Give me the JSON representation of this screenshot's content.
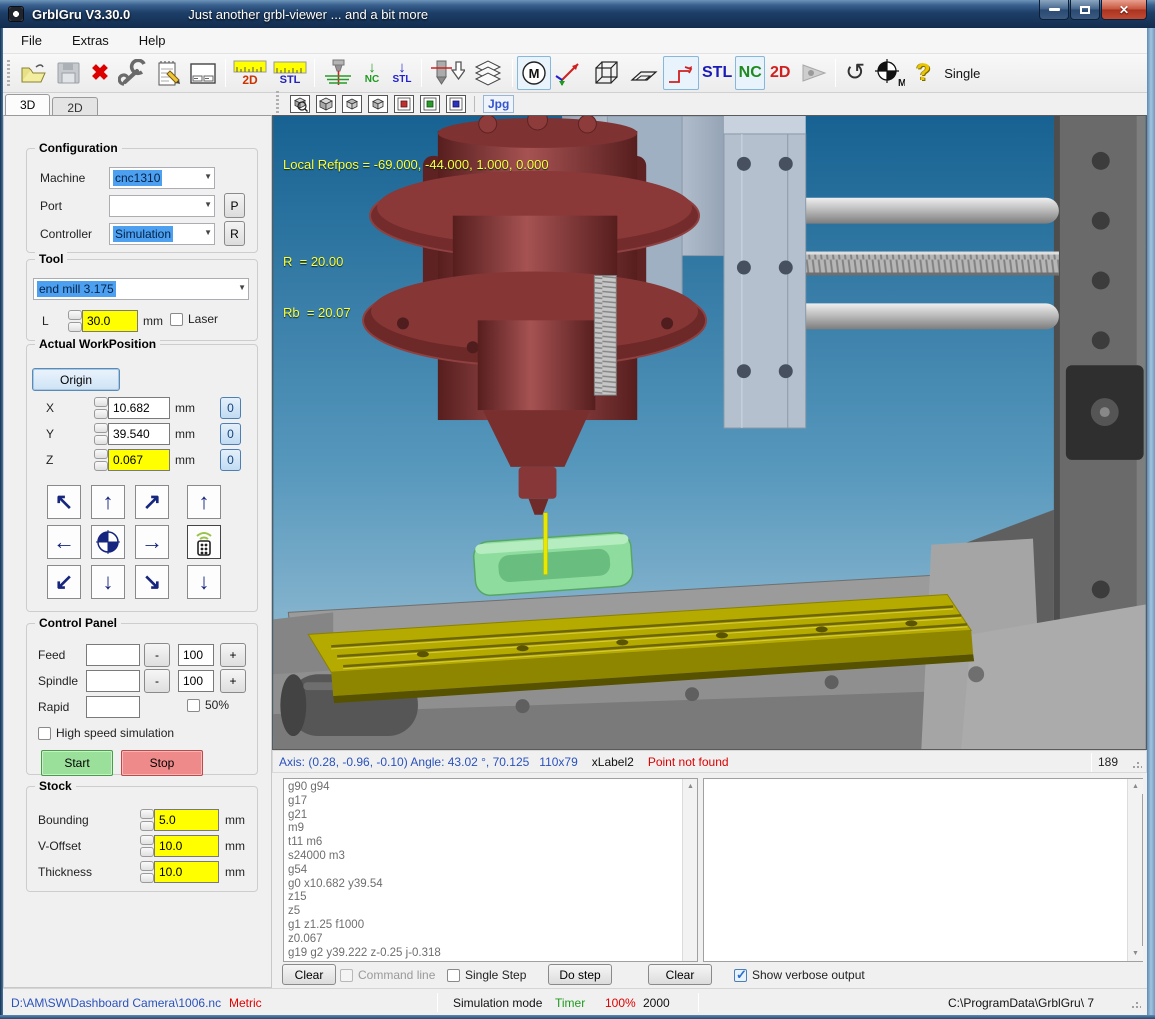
{
  "window": {
    "title": "GrblGru V3.30.0",
    "subtitle": "Just another grbl-viewer ... and a bit more"
  },
  "menu": {
    "file": "File",
    "extras": "Extras",
    "help": "Help"
  },
  "toolbar": {
    "ruler2d": "2D",
    "rulerstl": "STL",
    "nc_arrow": "NC",
    "stl_arrow": "STL",
    "m_badge": "M",
    "stl_text": "STL",
    "nc_text": "NC",
    "d2_text": "2D",
    "single": "Single"
  },
  "view_toolbar": {
    "jpg": "Jpg"
  },
  "tabs": {
    "t3d": "3D",
    "t2d": "2D"
  },
  "configuration": {
    "title": "Configuration",
    "machine_label": "Machine",
    "machine_value": "cnc1310",
    "port_label": "Port",
    "port_value": "",
    "controller_label": "Controller",
    "controller_value": "Simulation",
    "p_button": "P",
    "r_button": "R"
  },
  "tool": {
    "title": "Tool",
    "selected": "end mill 3.175",
    "l_label": "L",
    "length_value": "30.0",
    "unit": "mm",
    "laser_label": "Laser"
  },
  "work_position": {
    "title": "Actual WorkPosition",
    "origin_button": "Origin",
    "x_label": "X",
    "x_value": "10.682",
    "y_label": "Y",
    "y_value": "39.540",
    "z_label": "Z",
    "z_value": "0.067",
    "unit": "mm",
    "zero": "0"
  },
  "control_panel": {
    "title": "Control Panel",
    "feed_label": "Feed",
    "spindle_label": "Spindle",
    "rapid_label": "Rapid",
    "minus": "-",
    "plus": "+",
    "feed_percent": "100",
    "spindle_percent": "100",
    "fifty": "50%",
    "high_speed": "High speed simulation",
    "start": "Start",
    "stop": "Stop"
  },
  "stock": {
    "title": "Stock",
    "bounding_label": "Bounding",
    "bounding_value": "5.0",
    "voffset_label": "V-Offset",
    "voffset_value": "10.0",
    "thickness_label": "Thickness",
    "thickness_value": "10.0",
    "unit": "mm"
  },
  "viewport": {
    "overlay_refpos": "Local Refpos = -69.000, -44.000, 1.000, 0.000",
    "overlay_r": "R  = 20.00",
    "overlay_rb": "Rb  = 20.07"
  },
  "status_strip": {
    "axis_info": "Axis: (0.28, -0.96, -0.10) Angle: 43.02 °, 70.125   110x79",
    "xlabel": "xLabel2",
    "message": "Point not found",
    "counter": "189"
  },
  "gcode": {
    "lines": [
      "g90 g94",
      "g17",
      "g21",
      "m9",
      "t11 m6",
      "s24000 m3",
      "g54",
      "g0 x10.682 y39.54",
      "z15",
      "z5",
      "g1 z1.25 f1000",
      "z0.067",
      "g19 g2 y39.222 z-0.25 j-0.318"
    ]
  },
  "bottom_controls": {
    "clear_left": "Clear",
    "command_line": "Command line",
    "single_step": "Single Step",
    "do_step": "Do step",
    "clear_right": "Clear",
    "show_verbose": "Show verbose output"
  },
  "status_bar": {
    "file_path": "D:\\AM\\SW\\Dashboard Camera\\1006.nc",
    "units": "Metric",
    "mode": "Simulation mode",
    "timer": "Timer",
    "percent": "100%",
    "value": "2000",
    "data_path": "C:\\ProgramData\\GrblGru\\ 7"
  },
  "colors": {
    "field_highlight": "#ffff00",
    "start_green": "#9ae09a",
    "stop_red": "#ef8a8a",
    "selection_blue": "#4da0f0",
    "overlay_yellow": "#ffff33"
  },
  "icons": {
    "close": "✕",
    "delete_x": "✖",
    "rotate": "↺",
    "help_q": "?",
    "down_green": "↓",
    "down_blue": "↓",
    "combo": "▼",
    "check": "✓",
    "scroll_up": "▲",
    "scroll_down": "▼",
    "jog_ul": "↖",
    "jog_u": "↑",
    "jog_ur": "↗",
    "jog_l": "←",
    "jog_r": "→",
    "jog_dl": "↙",
    "jog_d": "↓",
    "jog_dr": "↘",
    "jog_zu": "↑",
    "jog_zd": "↓"
  }
}
